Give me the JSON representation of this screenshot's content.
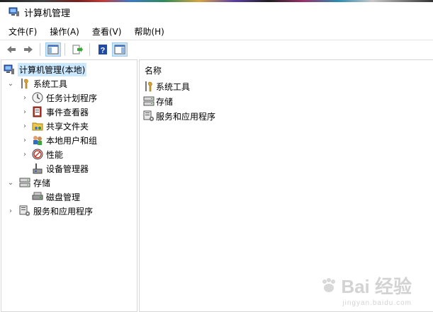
{
  "window": {
    "title": "计算机管理"
  },
  "menu": [
    {
      "label": "文件(F)"
    },
    {
      "label": "操作(A)"
    },
    {
      "label": "查看(V)"
    },
    {
      "label": "帮助(H)"
    }
  ],
  "toolbar": [
    {
      "icon": "back-arrow-icon"
    },
    {
      "icon": "forward-arrow-icon"
    },
    {
      "icon": "show-hide-console-tree-icon"
    },
    {
      "icon": "export-list-icon"
    },
    {
      "icon": "help-icon"
    },
    {
      "icon": "show-action-pane-icon"
    }
  ],
  "tree": {
    "root": {
      "label": "计算机管理(本地)",
      "icon": "computer-management-icon"
    },
    "items": [
      {
        "label": "系统工具",
        "icon": "tools-icon",
        "expander": "expanded"
      },
      {
        "label": "任务计划程序",
        "icon": "clock-icon",
        "expander": "collapsed"
      },
      {
        "label": "事件查看器",
        "icon": "event-viewer-icon",
        "expander": "collapsed"
      },
      {
        "label": "共享文件夹",
        "icon": "shared-folder-icon",
        "expander": "collapsed"
      },
      {
        "label": "本地用户和组",
        "icon": "users-icon",
        "expander": "collapsed"
      },
      {
        "label": "性能",
        "icon": "performance-icon",
        "expander": "collapsed"
      },
      {
        "label": "设备管理器",
        "icon": "device-manager-icon",
        "expander": "none"
      },
      {
        "label": "存储",
        "icon": "storage-icon",
        "expander": "expanded"
      },
      {
        "label": "磁盘管理",
        "icon": "disk-icon",
        "expander": "none"
      },
      {
        "label": "服务和应用程序",
        "icon": "services-icon",
        "expander": "collapsed"
      }
    ]
  },
  "list": {
    "column_header": "名称",
    "items": [
      {
        "label": "系统工具",
        "icon": "tools-icon"
      },
      {
        "label": "存储",
        "icon": "storage-icon"
      },
      {
        "label": "服务和应用程序",
        "icon": "services-icon"
      }
    ]
  },
  "watermark": {
    "text": "Bai 经验",
    "sub": "jingyan.baidu.com"
  }
}
